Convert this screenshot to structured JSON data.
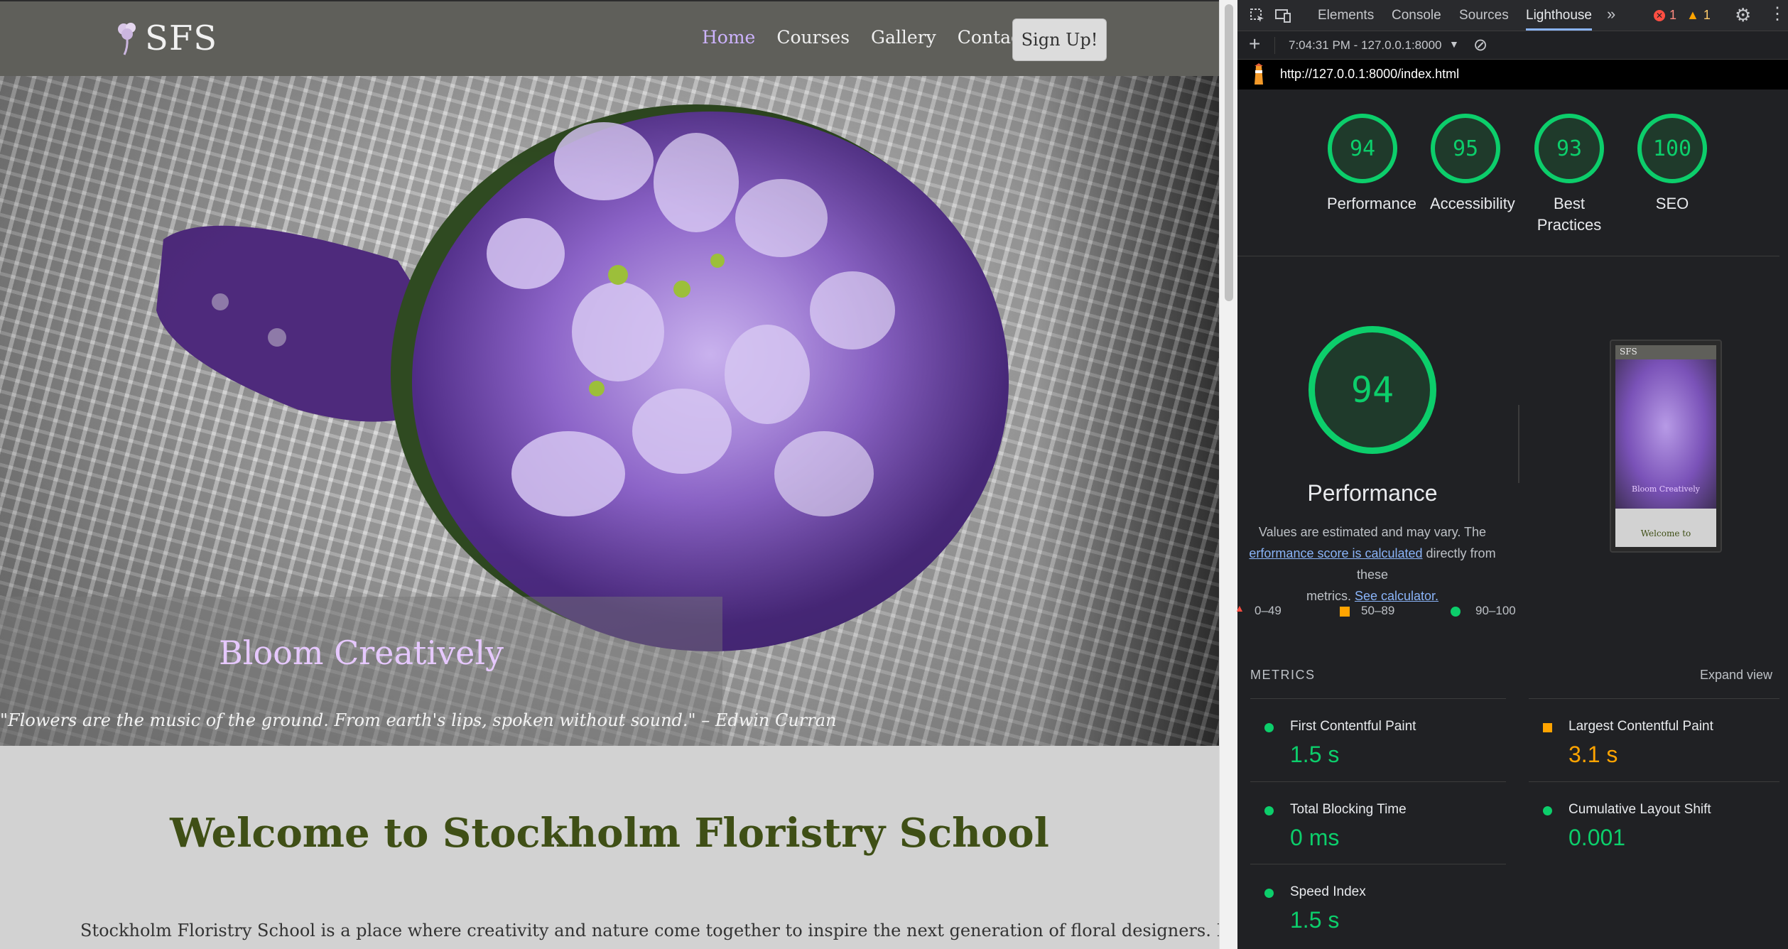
{
  "site": {
    "logo": "SFS",
    "nav": [
      "Home",
      "Courses",
      "Gallery",
      "Contacts"
    ],
    "signup": "Sign Up!",
    "hero_title": "Bloom Creatively",
    "hero_quote": "\"Flowers are the music of the ground. From earth's lips, spoken without sound.\" – Edwin Curran",
    "welcome": "Welcome to Stockholm Floristry School",
    "intro": "Stockholm Floristry School is a place where creativity and nature come together to inspire the next generation of floral designers. Founded"
  },
  "devtools": {
    "tabs": [
      "Elements",
      "Console",
      "Sources",
      "Lighthouse"
    ],
    "errors": "1",
    "warnings": "1",
    "report_label": "7:04:31 PM - 127.0.0.1:8000",
    "url": "http://127.0.0.1:8000/index.html",
    "scores": [
      {
        "label": "Performance",
        "score": "94"
      },
      {
        "label": "Accessibility",
        "score": "95"
      },
      {
        "label": "Best Practices",
        "score": "93"
      },
      {
        "label": "SEO",
        "score": "100"
      }
    ],
    "perf_score": "94",
    "perf_title": "Performance",
    "perf_desc_1": "Values are estimated and may vary. The",
    "perf_desc_link1": "erformance score is calculated",
    "perf_desc_2": "directly from these",
    "perf_desc_3": "metrics.",
    "perf_desc_link2": "See calculator.",
    "thumb_logo": "SFS",
    "thumb_title": "Bloom Creatively",
    "thumb_welcome": "Welcome to",
    "legend": [
      "0–49",
      "50–89",
      "90–100"
    ],
    "metrics_title": "METRICS",
    "expand_view": "Expand view",
    "metrics": [
      {
        "name": "First Contentful Paint",
        "value": "1.5 s",
        "status": "good"
      },
      {
        "name": "Largest Contentful Paint",
        "value": "3.1 s",
        "status": "average"
      },
      {
        "name": "Total Blocking Time",
        "value": "0 ms",
        "status": "good"
      },
      {
        "name": "Cumulative Layout Shift",
        "value": "0.001",
        "status": "good"
      },
      {
        "name": "Speed Index",
        "value": "1.5 s",
        "status": "good"
      }
    ],
    "colors": {
      "good": "#0cce6b",
      "average": "#ffa400",
      "poor": "#ff4e42",
      "accent": "#8ab4f8"
    }
  }
}
